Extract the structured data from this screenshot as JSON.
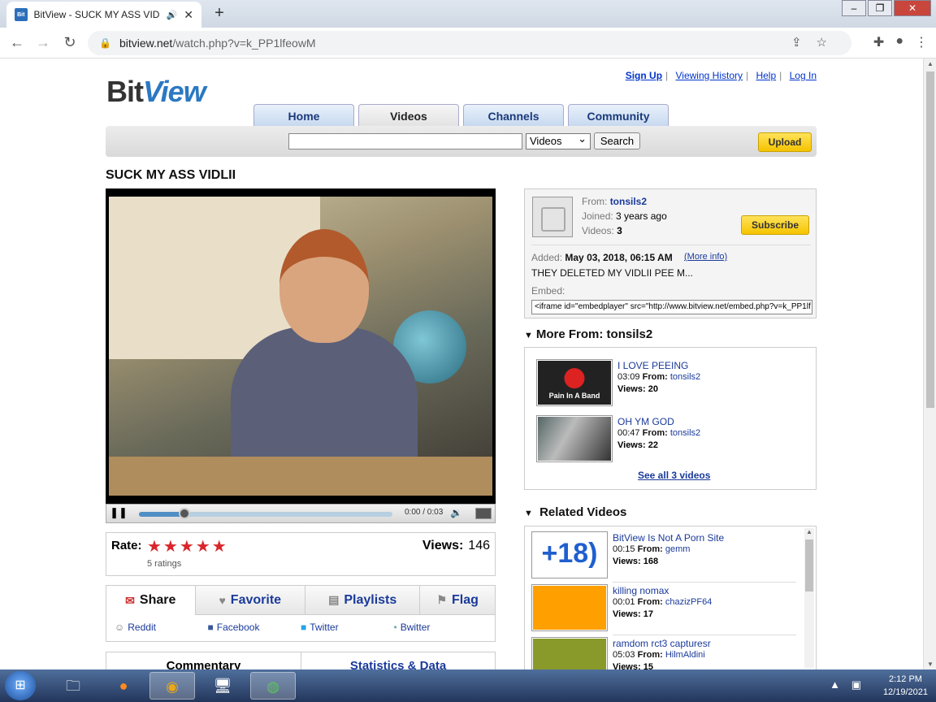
{
  "browser": {
    "tab_title": "BitView - SUCK MY ASS VIDL",
    "tab_favicon_text": "Bit",
    "url_host": "bitview.net",
    "url_path": "/watch.php?v=k_PP1lfeowM"
  },
  "site": {
    "logo_part1": "Bit",
    "logo_part2": "View",
    "top_links": [
      "Sign Up",
      "Viewing History",
      "Help",
      "Log In"
    ],
    "nav": [
      "Home",
      "Videos",
      "Channels",
      "Community"
    ],
    "active_nav": "Videos",
    "search_category": "Videos",
    "search_button": "Search",
    "upload_button": "Upload"
  },
  "video": {
    "title": "SUCK MY ASS VIDLII",
    "time": "0:00 / 0:03",
    "progress": 0.18,
    "rate_label": "Rate:",
    "stars": "★★★★★",
    "ratings_count": "5 ratings",
    "views_label": "Views:",
    "views": "146"
  },
  "share": {
    "tabs": [
      "Share",
      "Favorite",
      "Playlists",
      "Flag"
    ],
    "links": [
      "Reddit",
      "Facebook",
      "Twitter",
      "Bwitter"
    ]
  },
  "bottom_tabs": [
    "Commentary",
    "Statistics & Data"
  ],
  "uploader": {
    "from_label": "From:",
    "name": "tonsils2",
    "joined_label": "Joined:",
    "joined": "3 years ago",
    "videos_label": "Videos:",
    "videos": "3",
    "subscribe": "Subscribe",
    "added_label": "Added:",
    "added": "May 03, 2018, 06:15 AM",
    "more_info": "(More info)",
    "description": "THEY DELETED MY VIDLII PEE M...",
    "embed_label": "Embed:",
    "embed_code": "<iframe id=\"embedplayer\" src=\"http://www.bitview.net/embed.php?v=k_PP1lf"
  },
  "more_from": {
    "heading": "More From: tonsils2",
    "items": [
      {
        "title": "I LOVE PEEING",
        "duration": "03:09",
        "from_label": "From:",
        "from": "tonsils2",
        "views_label": "Views:",
        "views": "20",
        "thumb_text": "Pain In A Band"
      },
      {
        "title": "OH YM GOD",
        "duration": "00:47",
        "from_label": "From:",
        "from": "tonsils2",
        "views_label": "Views:",
        "views": "22"
      }
    ],
    "see_all": "See all 3 videos"
  },
  "related": {
    "heading": "Related Videos",
    "items": [
      {
        "title": "BitView Is Not A Porn Site",
        "duration": "00:15",
        "from_label": "From:",
        "from": "gemm",
        "views_label": "Views:",
        "views": "168",
        "thumb_text": "+18)"
      },
      {
        "title": "killing nomax",
        "duration": "00:01",
        "from_label": "From:",
        "from": "chazizPF64",
        "views_label": "Views:",
        "views": "17"
      },
      {
        "title": "ramdom rct3 capturesr",
        "duration": "05:03",
        "from_label": "From:",
        "from": "HilmAldini",
        "views_label": "Views:",
        "views": "15"
      }
    ]
  },
  "taskbar": {
    "time": "2:12 PM",
    "date": "12/19/2021"
  }
}
